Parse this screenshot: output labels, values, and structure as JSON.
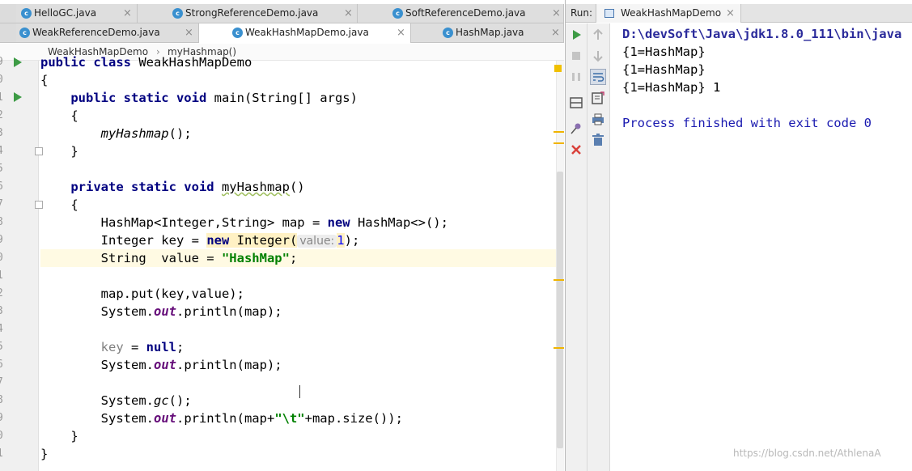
{
  "editor": {
    "tabs_row1": [
      {
        "label": "HelloGC.java"
      },
      {
        "label": "StrongReferenceDemo.java"
      },
      {
        "label": "SoftReferenceDemo.java"
      }
    ],
    "tabs_row2": [
      {
        "label": "WeakReferenceDemo.java"
      },
      {
        "label": "WeakHashMapDemo.java",
        "active": true
      },
      {
        "label": "HashMap.java"
      }
    ],
    "close_glyph": "×",
    "class_icon_letter": "c",
    "breadcrumb": {
      "class": "WeakHashMapDemo",
      "separator": "›",
      "method": "myHashmap()"
    },
    "line_numbers": [
      "9",
      "0",
      "1",
      "2",
      "3",
      "4",
      "5",
      "6",
      "7",
      "8",
      "9",
      "0",
      "1",
      "2",
      "3",
      "4",
      "5",
      "6",
      "7",
      "8",
      "9",
      "0",
      "1"
    ],
    "code": {
      "l1": {
        "kw": "public class ",
        "rest": "WeakHashMapDemo"
      },
      "l2": {
        "text": "{"
      },
      "l3": {
        "indent": "    ",
        "kw": "public static void ",
        "rest": "main(String[] args)"
      },
      "l4": {
        "text": "    {"
      },
      "l5": {
        "indent": "        ",
        "call": "myHashmap",
        "rest": "();"
      },
      "l6": {
        "text": "    }"
      },
      "l7": {
        "text": ""
      },
      "l8": {
        "indent": "    ",
        "kw": "private static void ",
        "name": "myHashmap",
        "rest": "()"
      },
      "l9": {
        "text": "    {"
      },
      "l10": {
        "indent": "        ",
        "pre": "HashMap<Integer,String> map = ",
        "kw": "new",
        "rest": " HashMap<>();"
      },
      "l11": {
        "indent": "        ",
        "pre": "Integer key = ",
        "kw": "new",
        "mid": " Integer(",
        "hint": "value:",
        "num": "1",
        "rest": ");"
      },
      "l12": {
        "indent": "        ",
        "pre": "String  value = ",
        "str": "\"HashMap\"",
        "rest": ";"
      },
      "l13": {
        "text": ""
      },
      "l14": {
        "text": "        map.put(key,value);"
      },
      "l15": {
        "indent": "        ",
        "pre": "System.",
        "fld": "out",
        "rest": ".println(map);"
      },
      "l16": {
        "text": ""
      },
      "l17": {
        "indent": "        ",
        "dim": "key",
        "pre": " = ",
        "kw": "null",
        "rest": ";"
      },
      "l18": {
        "indent": "        ",
        "pre": "System.",
        "fld": "out",
        "rest": ".println(map);"
      },
      "l19": {
        "text": ""
      },
      "l20": {
        "indent": "        ",
        "pre": "System.",
        "call": "gc",
        "rest": "();"
      },
      "l21": {
        "indent": "        ",
        "pre": "System.",
        "fld": "out",
        "mid": ".println(map+",
        "str": "\"\\t\"",
        "rest": "+map.size());"
      },
      "l22": {
        "text": "    }"
      },
      "l23": {
        "text": "}"
      }
    }
  },
  "run_panel": {
    "label": "Run:",
    "tab": "WeakHashMapDemo",
    "close_glyph": "×",
    "output": [
      "D:\\devSoft\\Java\\jdk1.8.0_111\\bin\\java",
      "{1=HashMap}",
      "{1=HashMap}",
      "{1=HashMap} 1",
      "",
      "Process finished with exit code 0"
    ],
    "icons": [
      "run-icon",
      "stop-icon",
      "pause-icon",
      "layout-icon",
      "pin-icon",
      "close-icon",
      "up-icon",
      "down-icon",
      "soft-wrap-icon",
      "export-icon",
      "print-icon",
      "trash-icon"
    ]
  },
  "watermark": "https://blog.csdn.net/AthlenaA",
  "colors": {
    "keyword": "#000080",
    "string": "#008000",
    "field": "#660e7a",
    "run_green": "#3d9b45",
    "warning": "#f0b400",
    "current_line": "#fffae3"
  }
}
